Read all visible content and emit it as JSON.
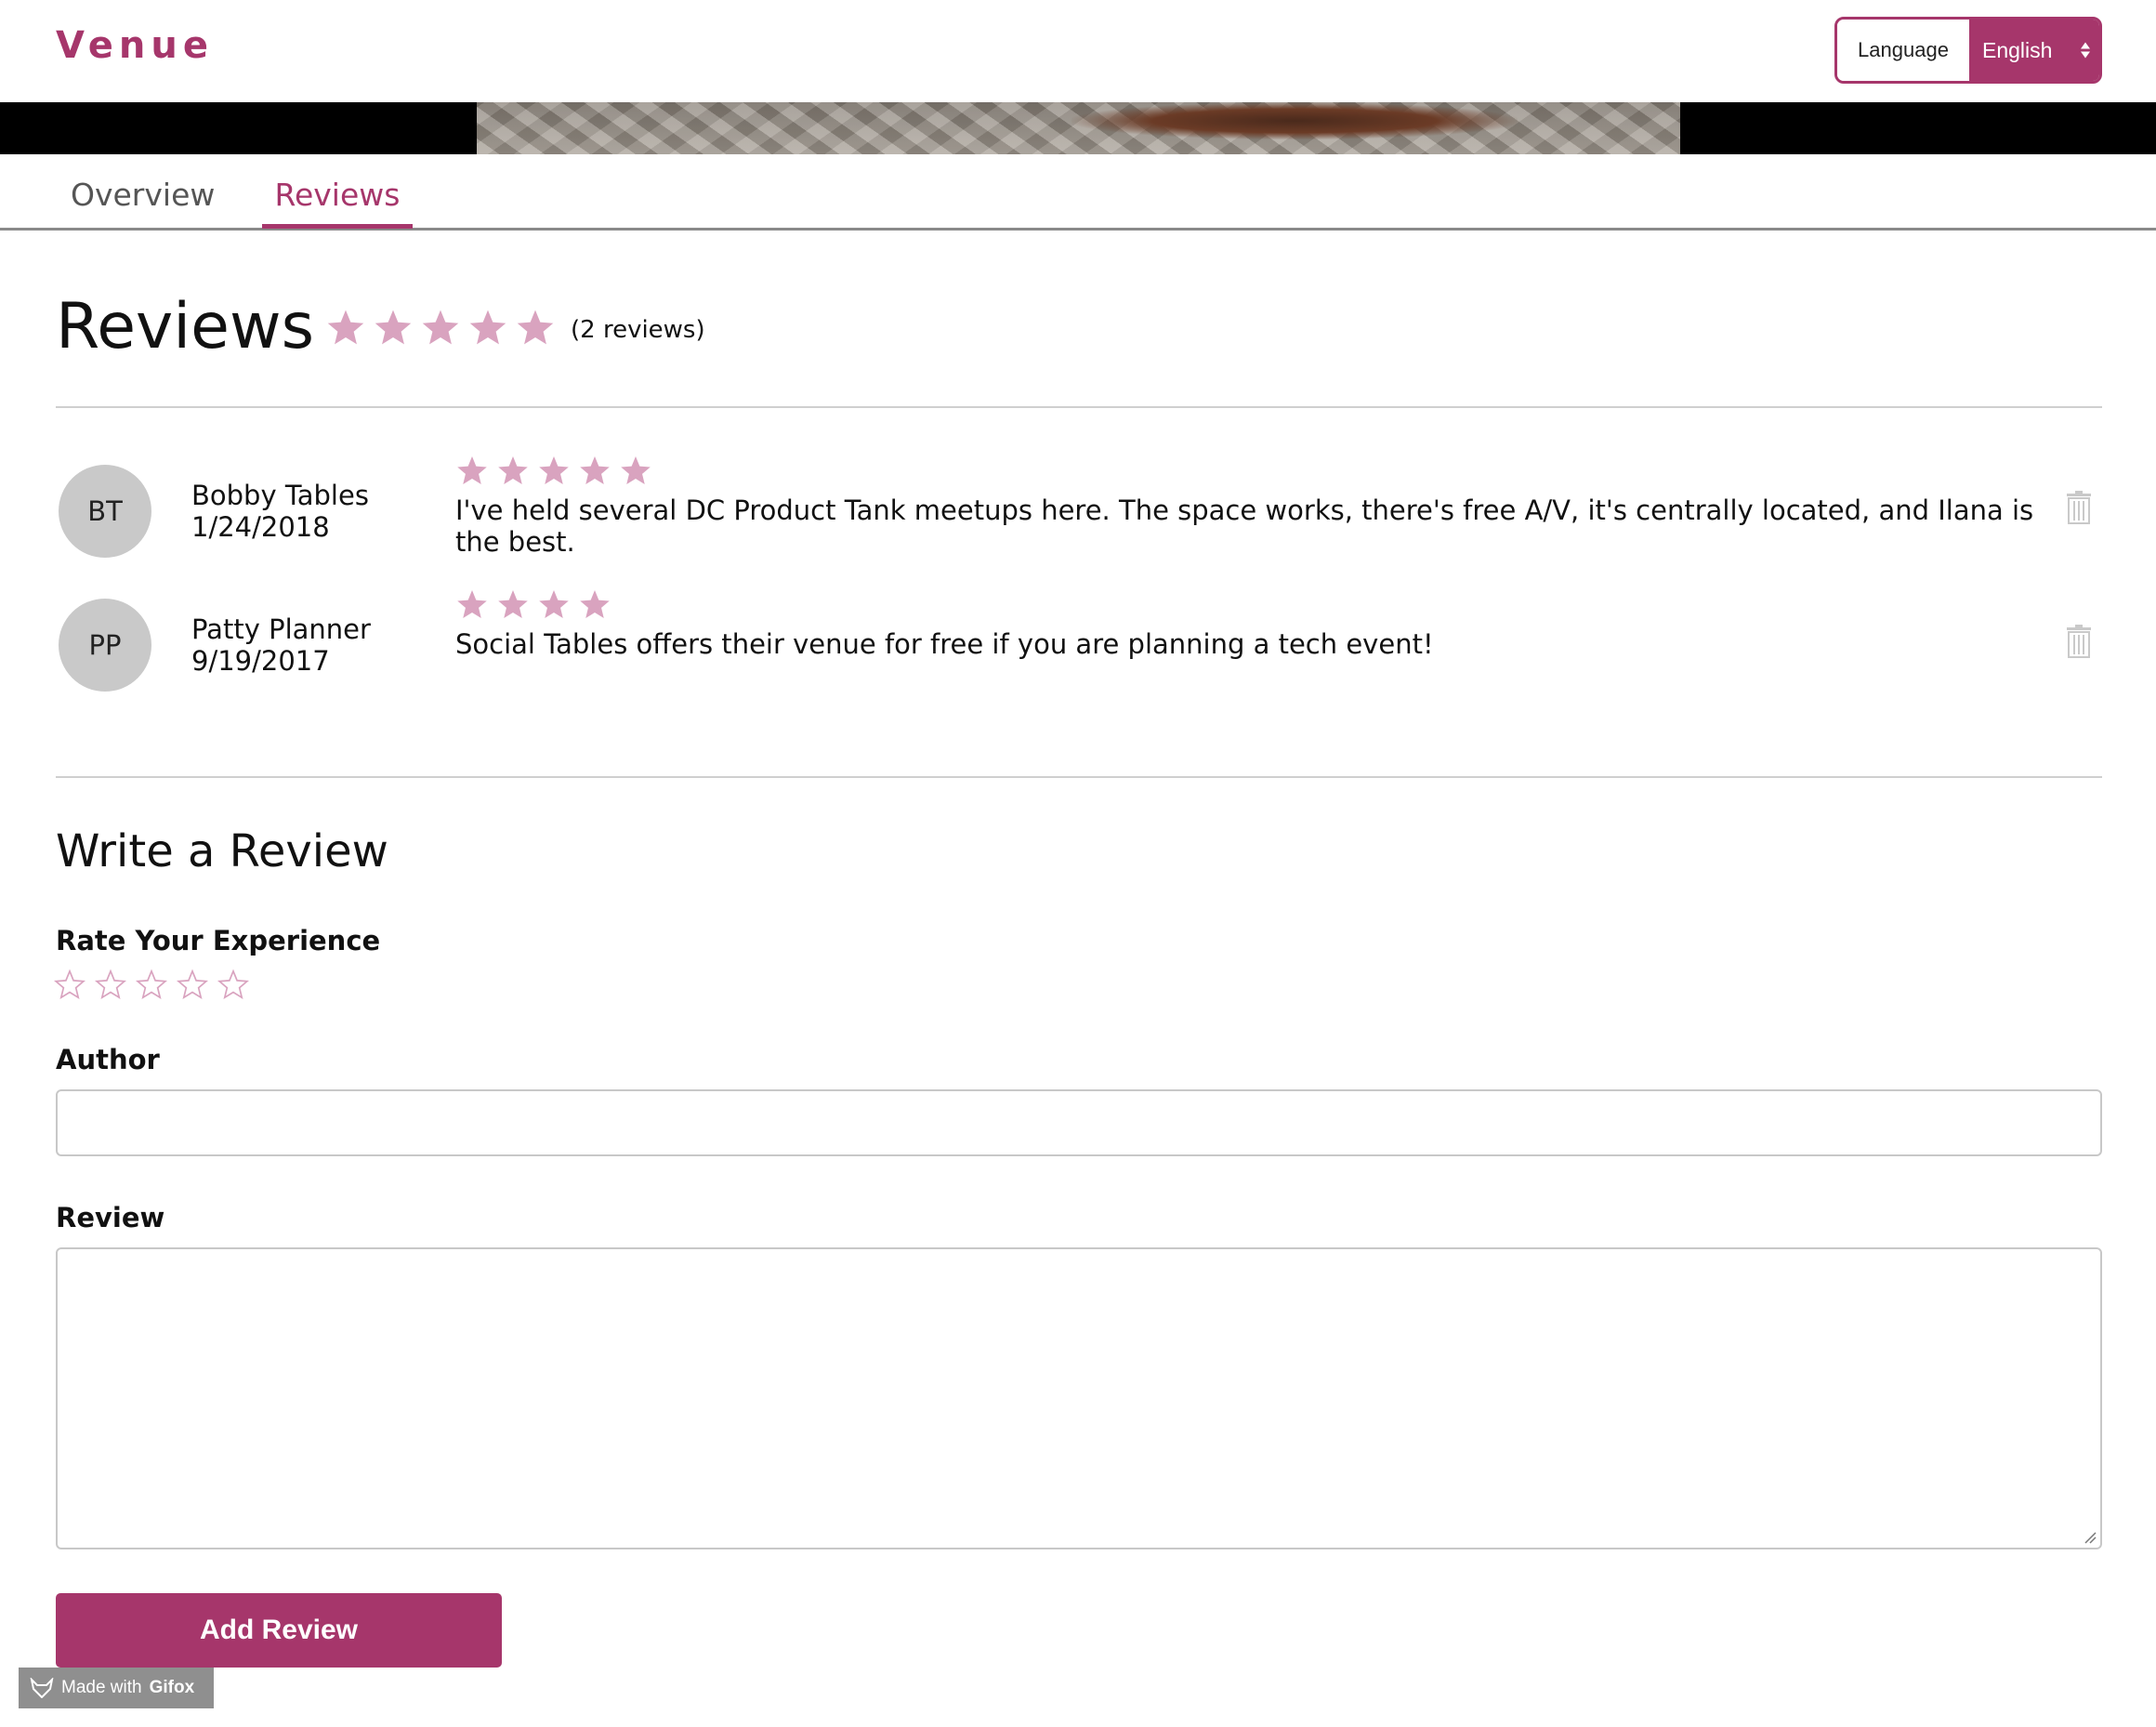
{
  "header": {
    "logo": "Venue",
    "language_label": "Language",
    "language_value": "English"
  },
  "tabs": [
    {
      "label": "Overview",
      "active": false
    },
    {
      "label": "Reviews",
      "active": true
    }
  ],
  "reviews_section": {
    "title": "Reviews",
    "average_rating": 5,
    "count_text": "(2 reviews)"
  },
  "reviews": [
    {
      "initials": "BT",
      "author": "Bobby Tables",
      "date": "1/24/2018",
      "rating": 5,
      "text": "I've held several DC Product Tank meetups here. The space works, there's free A/V, it's centrally located, and Ilana is the best."
    },
    {
      "initials": "PP",
      "author": "Patty Planner",
      "date": "9/19/2017",
      "rating": 4,
      "text": "Social Tables offers their venue for free if you are planning a tech event!"
    }
  ],
  "form": {
    "title": "Write a Review",
    "rate_label": "Rate Your Experience",
    "rating": 0,
    "author_label": "Author",
    "author_value": "",
    "review_label": "Review",
    "review_value": "",
    "submit_label": "Add Review"
  },
  "watermark": {
    "prefix": "Made with",
    "brand": "Gifox"
  },
  "colors": {
    "brand": "#a6366b",
    "star_filled": "#d9a3bf",
    "star_empty_outline": "#d9a3bf",
    "avatar_bg": "#c9c9c9"
  }
}
